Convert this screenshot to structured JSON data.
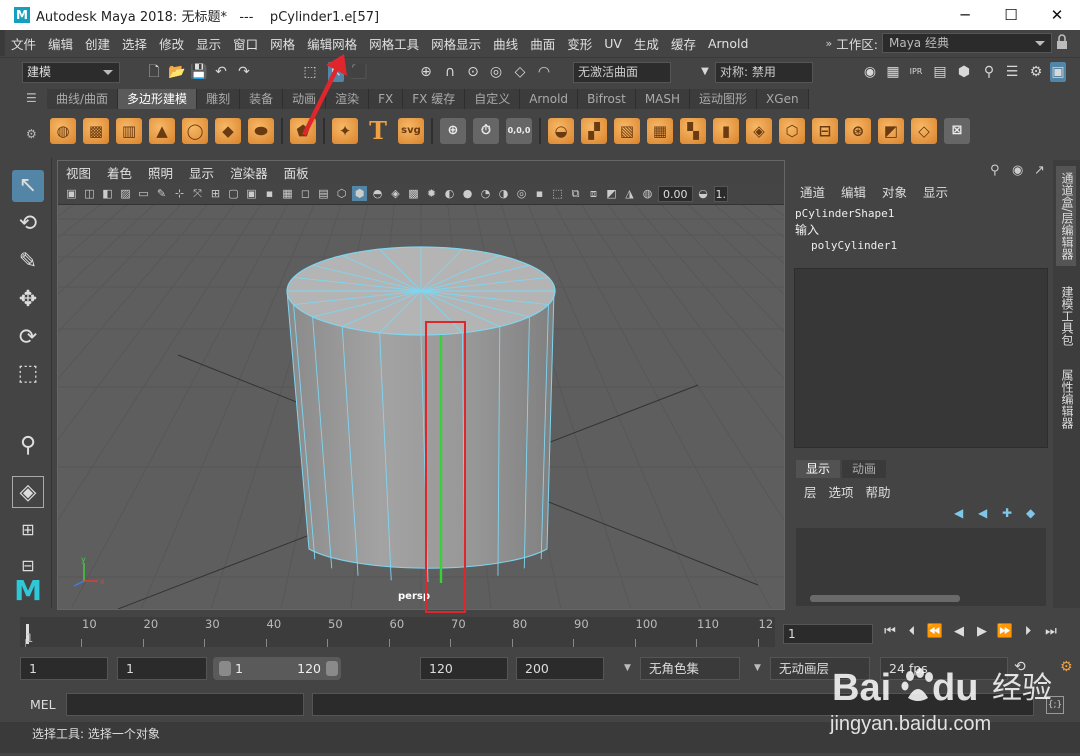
{
  "title_bar": {
    "app_icon": "M",
    "title": "Autodesk Maya 2018: 无标题*   ---    pCylinder1.e[57]",
    "minimize": "─",
    "maximize": "☐",
    "close": "✕"
  },
  "menu": [
    "文件",
    "编辑",
    "创建",
    "选择",
    "修改",
    "显示",
    "窗口",
    "网格",
    "编辑网格",
    "网格工具",
    "网格显示",
    "曲线",
    "曲面",
    "变形",
    "UV",
    "生成",
    "缓存",
    "Arnold"
  ],
  "workspace": {
    "label": "工作区:",
    "value": "Maya 经典"
  },
  "status_line": {
    "mode": "建模",
    "live_surface": "无激活曲面",
    "symmetry": "对称: 禁用"
  },
  "shelf_tabs": [
    "曲线/曲面",
    "多边形建模",
    "雕刻",
    "装备",
    "动画",
    "渲染",
    "FX",
    "FX 缓存",
    "自定义",
    "Arnold",
    "Bifrost",
    "MASH",
    "运动图形",
    "XGen"
  ],
  "shelf_active": "多边形建模",
  "shelf_svg_label": "svg",
  "shelf_text_label": "T",
  "shelf_coords_label": "0,0,0",
  "viewport": {
    "menu": [
      "视图",
      "着色",
      "照明",
      "显示",
      "渲染器",
      "面板"
    ],
    "field_value": "0.00",
    "field2_value": "1.",
    "camera_label": "persp",
    "axis_x": "x",
    "axis_y": "y"
  },
  "channel_box": {
    "menu": [
      "通道",
      "编辑",
      "对象",
      "显示"
    ],
    "shape": "pCylinderShape1",
    "inputs_label": "输入",
    "input_node": "polyCylinder1"
  },
  "layer_editor": {
    "tabs": [
      "显示",
      "动画"
    ],
    "menu": [
      "层",
      "选项",
      "帮助"
    ]
  },
  "side_tabs": [
    "通道盒/层编辑器",
    "建模工具包",
    "属性编辑器"
  ],
  "timeline": {
    "ticks": [
      "1",
      "10",
      "20",
      "30",
      "40",
      "50",
      "60",
      "70",
      "80",
      "90",
      "100",
      "110",
      "12"
    ],
    "current_frame": "1"
  },
  "range": {
    "start": "1",
    "anim_start": "1",
    "slider_start": "1",
    "slider_end": "120",
    "anim_end": "120",
    "end": "200",
    "char_set": "无角色集",
    "anim_layer": "无动画层",
    "fps": "24 fps"
  },
  "command_line": {
    "label": "MEL"
  },
  "help_line": "选择工具: 选择一个对象",
  "watermark": {
    "brand_a": "Bai",
    "brand_b": "du",
    "brand_cn": "经验",
    "url": "jingyan.baidu.com"
  },
  "colors": {
    "accent": "#5285a6",
    "shelf_orange": "#d9822b",
    "wire": "#7fd6f0",
    "highlight": "#e0262d",
    "edge_green": "#38d238"
  }
}
